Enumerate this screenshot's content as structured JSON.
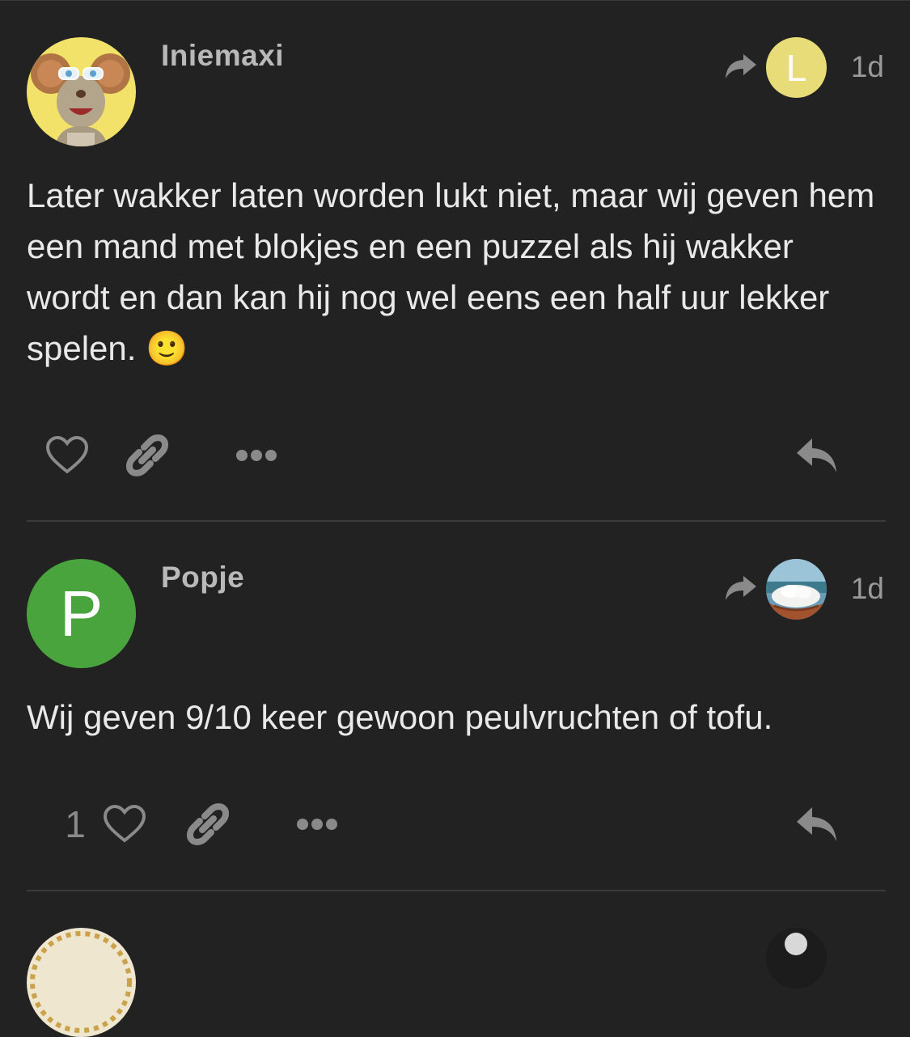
{
  "posts": [
    {
      "username": "Iniemaxi",
      "reply_to_initial": "L",
      "reply_to_avatar_color": "#e8dc78",
      "age": "1d",
      "body": "Later wakker laten worden lukt niet, maar wij geven hem een mand met blokjes en een puzzel als hij wakker wordt en dan kan hij nog wel eens een half uur lekker spelen. 🙂",
      "likes": ""
    },
    {
      "username": "Popje",
      "avatar_initial": "P",
      "avatar_color": "#4aa43e",
      "age": "1d",
      "body": "Wij geven 9/10 keer gewoon peulvruchten of tofu.",
      "likes": "1"
    }
  ],
  "colors": {
    "background": "#222222",
    "text": "#e9e9e9",
    "muted": "#9a9a9a",
    "icon": "#8a8a8a",
    "divider": "#3a3a3a"
  }
}
